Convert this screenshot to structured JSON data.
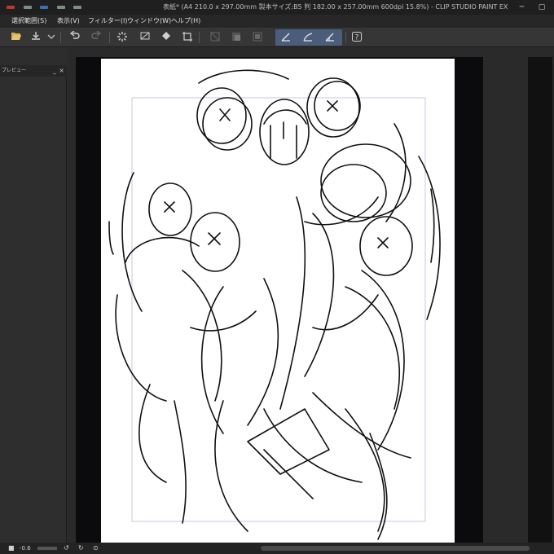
{
  "window": {
    "title": "表紙* (A4 210.0 x 297.00mm 製本サイズ:B5 判 182.00 x 257.00mm 600dpi 15.8%) - CLIP STUDIO PAINT EX"
  },
  "menubar": {
    "items": [
      "選択範囲(S)",
      "表示(V)",
      "フィルター(I)",
      "ウィンドウ(W)",
      "ヘルプ(H)"
    ]
  },
  "panel": {
    "title": "プレビュー",
    "minimize": "_",
    "close": "×"
  },
  "statusbar": {
    "zoom": "-0.6"
  },
  "colors": {
    "accent": "#4b5d7a",
    "paper": "#ffffff",
    "workspace": "#0b0b0d"
  },
  "icons": {
    "open": "folder-open-icon",
    "save": "save-icon",
    "undo": "undo-icon",
    "redo": "redo-icon",
    "loading": "busy-icon",
    "fill": "fill-icon",
    "crop": "crop-icon",
    "help": "help-icon"
  }
}
